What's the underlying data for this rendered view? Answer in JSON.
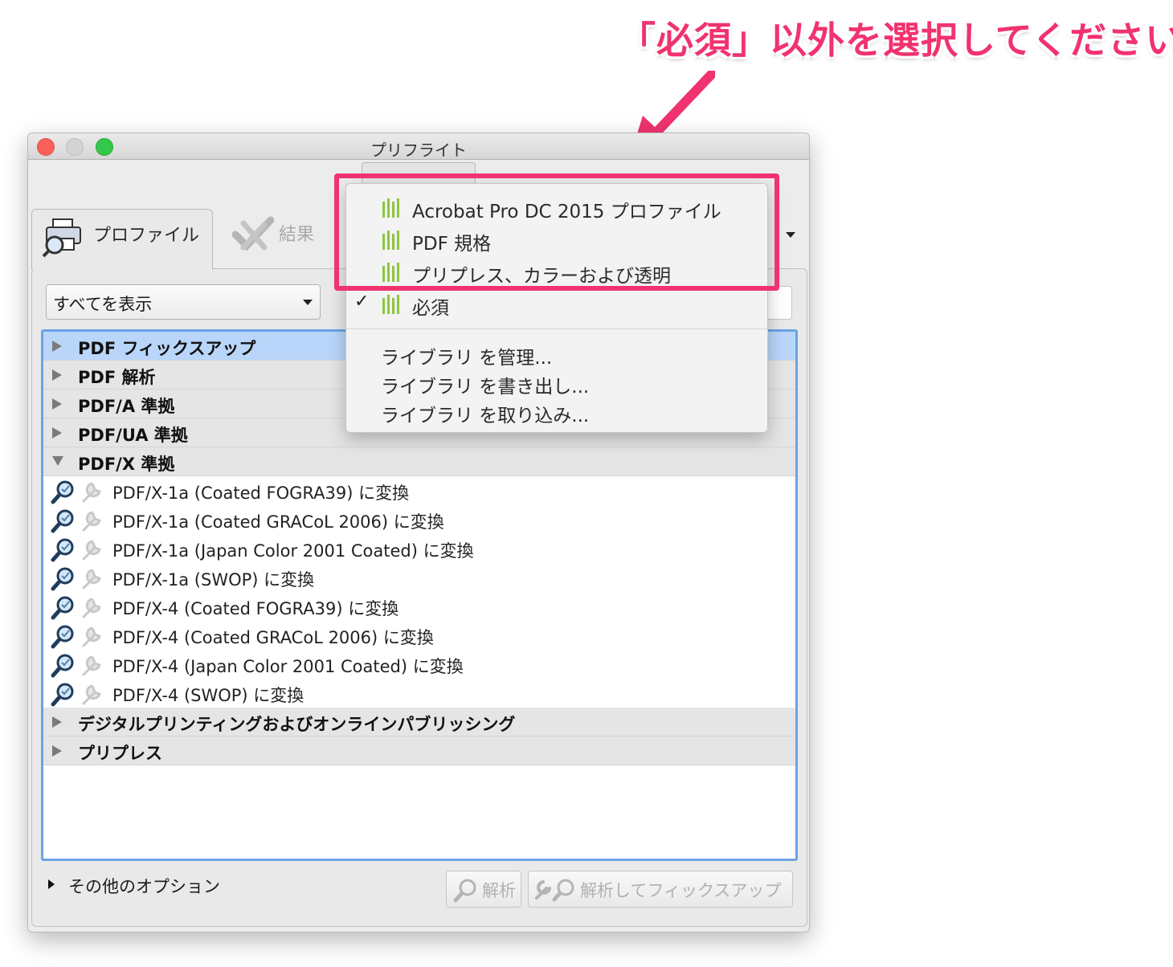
{
  "annotation": {
    "callout_text": "「必須」以外を選択してください",
    "accent_color": "#f0336f"
  },
  "window": {
    "title": "プリフライト"
  },
  "tabs": [
    {
      "label": "プロファイル",
      "icon": "profile-inspect-icon",
      "active": true
    },
    {
      "label": "結果",
      "icon": "results-check-icon",
      "active": false
    }
  ],
  "filter": {
    "value": "すべてを表示"
  },
  "tree": {
    "groups_top": [
      {
        "label": "PDF フィックスアップ",
        "selected": true,
        "expanded": false
      },
      {
        "label": "PDF 解析",
        "expanded": false
      },
      {
        "label": "PDF/A 準拠",
        "expanded": false
      },
      {
        "label": "PDF/UA 準拠",
        "expanded": false
      },
      {
        "label": "PDF/X 準拠",
        "expanded": true
      }
    ],
    "pdfx_items": [
      "PDF/X-1a (Coated FOGRA39) に変換",
      "PDF/X-1a (Coated GRACoL 2006) に変換",
      "PDF/X-1a (Japan Color 2001 Coated) に変換",
      "PDF/X-1a (SWOP) に変換",
      "PDF/X-4 (Coated FOGRA39) に変換",
      "PDF/X-4 (Coated GRACoL 2006) に変換",
      "PDF/X-4 (Japan Color 2001 Coated) に変換",
      "PDF/X-4 (SWOP) に変換"
    ],
    "groups_bottom": [
      {
        "label": "デジタルプリンティングおよびオンラインパブリッシング",
        "expanded": false
      },
      {
        "label": "プリプレス",
        "expanded": false
      }
    ]
  },
  "footer": {
    "more_options": "その他のオプション",
    "analyze_button": "解析",
    "analyze_fix_button": "解析してフィックスアップ"
  },
  "library_menu": {
    "libraries": [
      {
        "label": "Acrobat Pro DC 2015 プロファイル",
        "checked": false
      },
      {
        "label": "PDF 規格",
        "checked": false
      },
      {
        "label": "プリプレス、カラーおよび透明",
        "checked": false
      },
      {
        "label": "必須",
        "checked": true
      }
    ],
    "checkmark": "✓",
    "actions": [
      "ライブラリ を管理...",
      "ライブラリ を書き出し...",
      "ライブラリ を取り込み..."
    ],
    "bar_color": "#8cc63f"
  }
}
